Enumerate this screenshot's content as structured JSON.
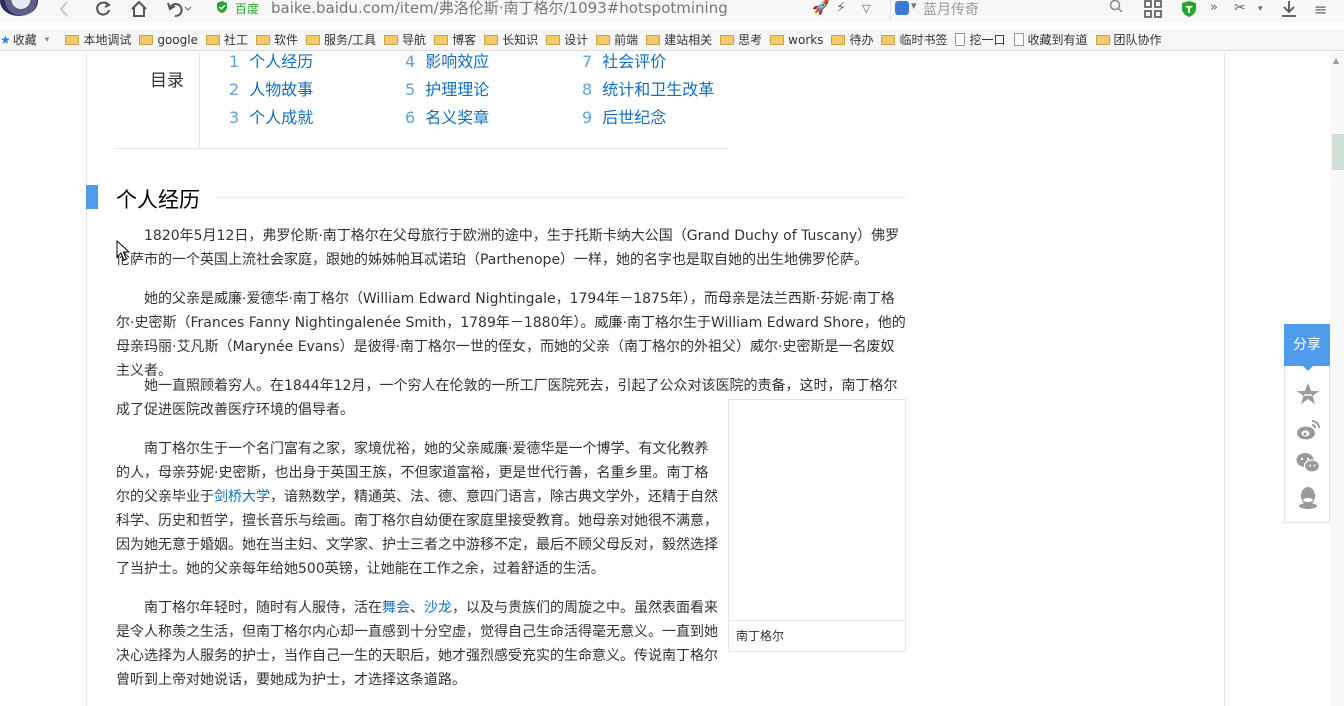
{
  "browser": {
    "site_badge": "百度",
    "url": "baike.baidu.com/item/弗洛伦斯·南丁格尔/1093#hotspotmining",
    "search_hint": "蓝月传奇"
  },
  "bookmarks": {
    "favorites_label": "收藏",
    "items": [
      {
        "label": "本地调试",
        "type": "folder"
      },
      {
        "label": "google",
        "type": "folder"
      },
      {
        "label": "社工",
        "type": "folder"
      },
      {
        "label": "软件",
        "type": "folder"
      },
      {
        "label": "服务/工具",
        "type": "folder"
      },
      {
        "label": "导航",
        "type": "folder"
      },
      {
        "label": "博客",
        "type": "folder"
      },
      {
        "label": "长知识",
        "type": "folder"
      },
      {
        "label": "设计",
        "type": "folder"
      },
      {
        "label": "前端",
        "type": "folder"
      },
      {
        "label": "建站相关",
        "type": "folder"
      },
      {
        "label": "思考",
        "type": "folder"
      },
      {
        "label": "works",
        "type": "folder"
      },
      {
        "label": "待办",
        "type": "folder"
      },
      {
        "label": "临时书签",
        "type": "folder"
      },
      {
        "label": "挖一口",
        "type": "page"
      },
      {
        "label": "收藏到有道",
        "type": "page"
      },
      {
        "label": "团队协作",
        "type": "folder"
      }
    ]
  },
  "toc": {
    "title": "目录",
    "items": [
      {
        "num": "1",
        "label": "个人经历"
      },
      {
        "num": "2",
        "label": "人物故事"
      },
      {
        "num": "3",
        "label": "个人成就"
      },
      {
        "num": "4",
        "label": "影响效应"
      },
      {
        "num": "5",
        "label": "护理理论"
      },
      {
        "num": "6",
        "label": "名义奖章"
      },
      {
        "num": "7",
        "label": "社会评价"
      },
      {
        "num": "8",
        "label": "统计和卫生改革"
      },
      {
        "num": "9",
        "label": "后世纪念"
      }
    ]
  },
  "section": {
    "title": "个人经历",
    "paragraphs": {
      "p1": "1820年5月12日，弗罗伦斯·南丁格尔在父母旅行于欧洲的途中，生于托斯卡纳大公国（Grand Duchy of Tuscany）佛罗伦萨市的一个英国上流社会家庭，跟她的姊姊帕耳忒诺珀（Parthenope）一样，她的名字也是取自她的出生地佛罗伦萨。",
      "p2": "她的父亲是威廉·爱德华·南丁格尔（William Edward Nightingale，1794年－1875年），而母亲是法兰西斯·芬妮·南丁格尔·史密斯（Frances Fanny Nightingalenée Smith，1789年－1880年）。威廉·南丁格尔生于William Edward Shore，他的母亲玛丽·艾凡斯（Marynée Evans）是彼得·南丁格尔一世的侄女，而她的父亲（南丁格尔的外祖父）威尔·史密斯是一名废奴主义者。",
      "p3": "她一直照顾着穷人。在1844年12月，一个穷人在伦敦的一所工厂医院死去，引起了公众对该医院的责备，这时，南丁格尔成了促进医院改善医疗环境的倡导者。",
      "p4_a": "南丁格尔生于一个名门富有之家，家境优裕，她的父亲威廉·爱德华是一个博学、有文化教养的人，母亲芬妮·史密斯，也出身于英国王族，不但家道富裕，更是世代行善，名重乡里。南丁格尔的父亲毕业于",
      "p4_link": "剑桥大学",
      "p4_b": "，谙熟数学，精通英、法、德、意四门语言，除古典文学外，还精于自然科学、历史和哲学，擅长音乐与绘画。南丁格尔自幼便在家庭里接受教育。她母亲对她很不满意，因为她无意于婚姻。她在当主妇、文学家、护士三者之中游移不定，最后不顾父母反对，毅然选择了当护士。她的父亲每年给她500英镑，让她能在工作之余，过着舒适的生活。",
      "p5_a": "南丁格尔年轻时，随时有人服侍，活在",
      "p5_link1": "舞会",
      "p5_sep": "、",
      "p5_link2": "沙龙",
      "p5_b": "，以及与贵族们的周旋之中。虽然表面看来是令人称羡之生活，但南丁格尔内心却一直感到十分空虚，觉得自己生命活得毫无意义。一直到她决心选择为人服务的护士，当作自己一生的天职后，她才强烈感受充实的生命意义。传说南丁格尔曾听到上帝对她说话，要她成为护士，才选择这条道路。"
    }
  },
  "image": {
    "caption": "南丁格尔"
  },
  "share": {
    "label": "分享"
  },
  "colors": {
    "accent": "#4f9cee",
    "link": "#136ec2",
    "site_badge": "#27a52c"
  }
}
